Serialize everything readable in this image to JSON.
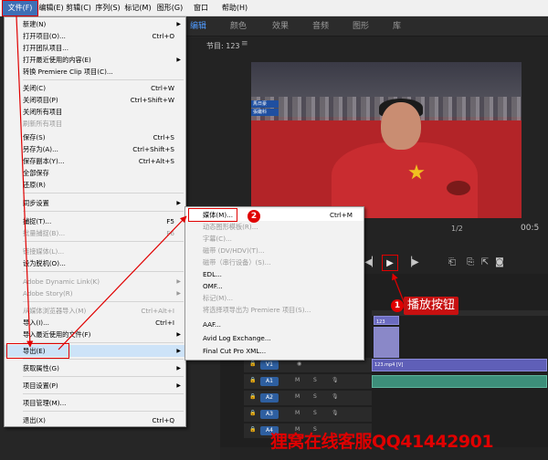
{
  "menubar": {
    "items": [
      "文件(F)",
      "编辑(E)",
      "剪辑(C)",
      "序列(S)",
      "标记(M)",
      "图形(G)",
      "窗口(W)",
      "帮助(H)"
    ]
  },
  "workspace_tabs": [
    "编辑",
    "颜色",
    "效果",
    "音频",
    "图形",
    "库"
  ],
  "monitor": {
    "title": "节目: 123",
    "menu_glyph": "≡",
    "zoom": "1/2",
    "timecode": "00:5"
  },
  "file_menu": {
    "items": [
      {
        "label": "新建(N)",
        "shortcut": "",
        "submenu": true,
        "disabled": false
      },
      {
        "label": "打开项目(O)...",
        "shortcut": "Ctrl+O",
        "submenu": false,
        "disabled": false
      },
      {
        "label": "打开团队项目...",
        "shortcut": "",
        "submenu": false,
        "disabled": false
      },
      {
        "label": "打开最近使用的内容(E)",
        "shortcut": "",
        "submenu": true,
        "disabled": false
      },
      {
        "label": "转换 Premiere Clip 项目(C)...",
        "shortcut": "",
        "submenu": false,
        "disabled": false
      },
      {
        "label": "关闭(C)",
        "shortcut": "Ctrl+W",
        "submenu": false,
        "disabled": false
      },
      {
        "label": "关闭项目(P)",
        "shortcut": "Ctrl+Shift+W",
        "submenu": false,
        "disabled": false
      },
      {
        "label": "关闭所有项目",
        "shortcut": "",
        "submenu": false,
        "disabled": false
      },
      {
        "label": "刷新所有项目",
        "shortcut": "",
        "submenu": false,
        "disabled": true
      },
      {
        "label": "保存(S)",
        "shortcut": "Ctrl+S",
        "submenu": false,
        "disabled": false
      },
      {
        "label": "另存为(A)...",
        "shortcut": "Ctrl+Shift+S",
        "submenu": false,
        "disabled": false
      },
      {
        "label": "保存副本(Y)...",
        "shortcut": "Ctrl+Alt+S",
        "submenu": false,
        "disabled": false
      },
      {
        "label": "全部保存",
        "shortcut": "",
        "submenu": false,
        "disabled": false
      },
      {
        "label": "还原(R)",
        "shortcut": "",
        "submenu": false,
        "disabled": false
      },
      {
        "label": "同步设置",
        "shortcut": "",
        "submenu": true,
        "disabled": false
      },
      {
        "label": "捕捉(T)...",
        "shortcut": "F5",
        "submenu": false,
        "disabled": false
      },
      {
        "label": "批量捕捉(B)...",
        "shortcut": "F6",
        "submenu": false,
        "disabled": true
      },
      {
        "label": "链接媒体(L)...",
        "shortcut": "",
        "submenu": false,
        "disabled": true
      },
      {
        "label": "设为脱机(O)...",
        "shortcut": "",
        "submenu": false,
        "disabled": false
      },
      {
        "label": "Adobe Dynamic Link(K)",
        "shortcut": "",
        "submenu": true,
        "disabled": true
      },
      {
        "label": "Adobe Story(R)",
        "shortcut": "",
        "submenu": true,
        "disabled": true
      },
      {
        "label": "从媒体浏览器导入(M)",
        "shortcut": "Ctrl+Alt+I",
        "submenu": false,
        "disabled": true
      },
      {
        "label": "导入(I)...",
        "shortcut": "Ctrl+I",
        "submenu": false,
        "disabled": false
      },
      {
        "label": "导入最近使用的文件(F)",
        "shortcut": "",
        "submenu": true,
        "disabled": false
      },
      {
        "label": "导出(E)",
        "shortcut": "",
        "submenu": true,
        "disabled": false
      },
      {
        "label": "获取属性(G)",
        "shortcut": "",
        "submenu": true,
        "disabled": false
      },
      {
        "label": "项目设置(P)",
        "shortcut": "",
        "submenu": true,
        "disabled": false
      },
      {
        "label": "项目管理(M)...",
        "shortcut": "",
        "submenu": false,
        "disabled": false
      },
      {
        "label": "退出(X)",
        "shortcut": "Ctrl+Q",
        "submenu": false,
        "disabled": false
      }
    ]
  },
  "export_menu": {
    "items": [
      {
        "label": "媒体(M)...",
        "shortcut": "Ctrl+M",
        "disabled": false
      },
      {
        "label": "动态图形模板(R)...",
        "shortcut": "",
        "disabled": true
      },
      {
        "label": "字幕(C)...",
        "shortcut": "",
        "disabled": true
      },
      {
        "label": "磁带 (DV/HDV)(T)...",
        "shortcut": "",
        "disabled": true
      },
      {
        "label": "磁带（串行设备）(S)...",
        "shortcut": "",
        "disabled": true
      },
      {
        "label": "EDL...",
        "shortcut": "",
        "disabled": false
      },
      {
        "label": "OMF...",
        "shortcut": "",
        "disabled": false
      },
      {
        "label": "标记(M)...",
        "shortcut": "",
        "disabled": true
      },
      {
        "label": "将选择项导出为 Premiere 项目(S)...",
        "shortcut": "",
        "disabled": true
      },
      {
        "label": "AAF...",
        "shortcut": "",
        "disabled": false
      },
      {
        "label": "Avid Log Exchange...",
        "shortcut": "",
        "disabled": false
      },
      {
        "label": "Final Cut Pro XML...",
        "shortcut": "",
        "disabled": false
      }
    ]
  },
  "transport": {
    "icons": [
      "step-back-icon",
      "play-icon",
      "step-forward-icon",
      "insert-icon",
      "overwrite-icon",
      "export-frame-icon",
      "camera-icon"
    ]
  },
  "timeline": {
    "tracks": [
      {
        "label": "V1",
        "clip": "123.mp4 [V]"
      },
      {
        "label": "A1",
        "clip": ""
      },
      {
        "label": "A2",
        "clip": ""
      },
      {
        "label": "A3",
        "clip": ""
      },
      {
        "label": "A4",
        "clip": ""
      }
    ],
    "top_clip": "123"
  },
  "video": {
    "score_rows": [
      "馬日豪",
      "張繼科"
    ]
  },
  "callouts": {
    "one": "1",
    "two": "2",
    "play_text": "播放按钮"
  },
  "watermark": "狸窝在线客服QQ41442901",
  "colors": {
    "highlight_red": "#e00000",
    "menu_bg": "#f2f2f2",
    "accent_blue": "#4f9bff"
  }
}
